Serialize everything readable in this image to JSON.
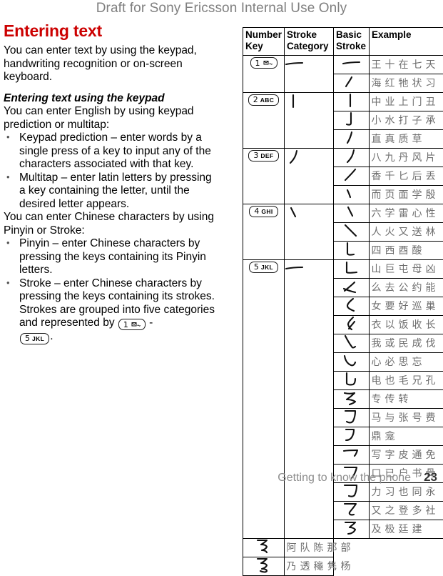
{
  "header": {
    "draft_notice": "Draft for Sony Ericsson Internal Use Only"
  },
  "content": {
    "title": "Entering text",
    "intro": "You can enter text by using the keypad, handwriting recognition or on-screen keyboard.",
    "subheading": "Entering text using the keypad",
    "subintro": "You can enter English by using keypad prediction or multitap:",
    "bullets_latin": [
      "Keypad prediction – enter words by a single press of a key to input any of the characters associated with that key.",
      "Multitap – enter latin letters by pressing a key containing the letter, until the desired letter appears."
    ],
    "chinese_intro": "You can enter Chinese characters by using Pinyin or Stroke:",
    "bullets_chinese": [
      {
        "text": "Pinyin – enter Chinese characters by pressing the keys containing its Pinyin letters."
      },
      {
        "text_before": "Stroke – enter Chinese characters by pressing the keys containing its strokes. Strokes are grouped into five categories and represented by ",
        "key_a": {
          "num": "1",
          "letters": "",
          "icon": "envelope-icon"
        },
        "separator": " - ",
        "key_b": {
          "num": "5",
          "letters": "JKL",
          "icon": ""
        },
        "text_after": "."
      }
    ]
  },
  "table": {
    "columns": [
      "Number Key",
      "Stroke Category",
      "Basic Stroke",
      "Example"
    ],
    "rows": [
      {
        "key": {
          "num": "1",
          "letters": "",
          "icon": "envelope-icon"
        },
        "key_rowspan": 2,
        "category": "heng",
        "category_rowspan": 2,
        "basic": "heng",
        "examples": [
          "王",
          "十",
          "在",
          "七",
          "天"
        ]
      },
      {
        "basic": "ti",
        "examples": [
          "海",
          "红",
          "牠",
          "状",
          "习"
        ]
      },
      {
        "key": {
          "num": "2",
          "letters": "ABC",
          "icon": ""
        },
        "key_rowspan": 3,
        "category": "shu",
        "category_rowspan": 3,
        "basic": "shu",
        "examples": [
          "中",
          "业",
          "上",
          "门",
          "丑"
        ]
      },
      {
        "basic": "shugou",
        "examples": [
          "小",
          "水",
          "打",
          "子",
          "承"
        ]
      },
      {
        "basic": "shupie",
        "examples": [
          "直",
          "真",
          "质",
          "草"
        ]
      },
      {
        "key": {
          "num": "3",
          "letters": "DEF",
          "icon": ""
        },
        "key_rowspan": 3,
        "category": "pie",
        "category_rowspan": 3,
        "basic": "pie",
        "examples": [
          "八",
          "九",
          "丹",
          "风",
          "片"
        ]
      },
      {
        "basic": "piezhe",
        "examples": [
          "香",
          "千",
          "匕",
          "后",
          "丢"
        ]
      },
      {
        "basic": "piedian",
        "examples": [
          "而",
          "页",
          "面",
          "学",
          "殷"
        ]
      },
      {
        "key": {
          "num": "4",
          "letters": "GHI",
          "icon": ""
        },
        "key_rowspan": 3,
        "category": "dian",
        "category_rowspan": 3,
        "basic": "dian",
        "examples": [
          "六",
          "学",
          "雷",
          "心",
          "性"
        ]
      },
      {
        "basic": "na",
        "examples": [
          "人",
          "火",
          "又",
          "送",
          "林"
        ]
      },
      {
        "basic": "shuwan",
        "examples": [
          "四",
          "西",
          "酉",
          "酸"
        ]
      },
      {
        "key": {
          "num": "5",
          "letters": "JKL",
          "icon": ""
        },
        "key_rowspan": 15,
        "category": "zhe",
        "category_rowspan": 15,
        "basic": "shuzhe",
        "examples": [
          "山",
          "巨",
          "屯",
          "母",
          "凶"
        ]
      },
      {
        "basic": "zhezhe",
        "examples": [
          "么",
          "去",
          "公",
          "约",
          "能"
        ]
      },
      {
        "basic": "zhewan",
        "examples": [
          "女",
          "要",
          "好",
          "巡",
          "巢"
        ]
      },
      {
        "basic": "pieti",
        "examples": [
          "衣",
          "以",
          "饭",
          "收",
          "长"
        ]
      },
      {
        "basic": "xiegou",
        "examples": [
          "我",
          "或",
          "民",
          "成",
          "伐"
        ]
      },
      {
        "basic": "wogou",
        "examples": [
          "心",
          "必",
          "思",
          "忘"
        ]
      },
      {
        "basic": "shuwangou",
        "examples": [
          "电",
          "也",
          "毛",
          "兄",
          "孔"
        ]
      },
      {
        "basic": "zhezhezhe",
        "examples": [
          "专",
          "传",
          "转"
        ]
      },
      {
        "basic": "shuzhezhegou",
        "examples": [
          "马",
          "与",
          "张",
          "号",
          "费"
        ]
      },
      {
        "basic": "shuzhepiegou",
        "examples": [
          "鼎",
          "龛"
        ]
      },
      {
        "basic": "hengou",
        "examples": [
          "写",
          "字",
          "皮",
          "通",
          "免"
        ]
      },
      {
        "basic": "hengzhe",
        "examples": [
          "口",
          "已",
          "户",
          "书",
          "骨"
        ]
      },
      {
        "basic": "hengzhegou",
        "examples": [
          "力",
          "习",
          "也",
          "同",
          "永"
        ]
      },
      {
        "basic": "hengpiewan",
        "examples": [
          "又",
          "之",
          "登",
          "多",
          "社"
        ]
      },
      {
        "basic": "hengzhezhe",
        "examples": [
          "及",
          "极",
          "廷",
          "建"
        ]
      },
      {
        "basic": "hengzhezhezhe",
        "examples": [
          "阿",
          "队",
          "陈",
          "那",
          "部"
        ]
      },
      {
        "basic": "hengzhezhezhegou",
        "examples": [
          "乃",
          "透",
          "龝",
          "隽",
          "杨"
        ]
      }
    ]
  },
  "footer": {
    "chapter": "Getting to know the phone",
    "page_number": "23"
  },
  "colors": {
    "title_red": "#cc0000",
    "draft_gray": "#808080",
    "example_gray": "#6e6e6e",
    "footer_gray": "#8c8c8c"
  }
}
